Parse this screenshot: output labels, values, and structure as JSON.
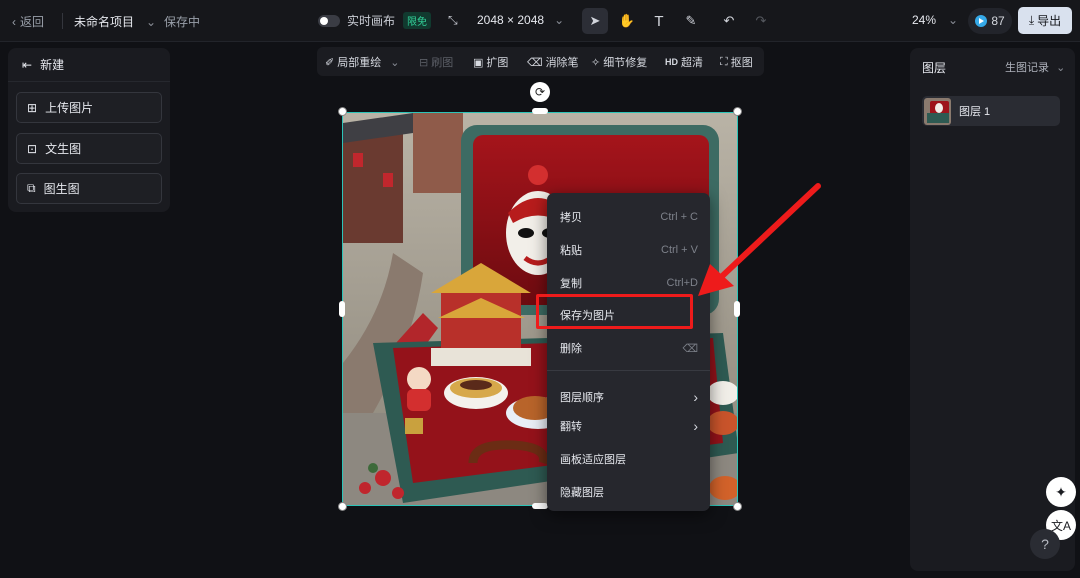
{
  "topbar": {
    "back_label": "返回",
    "project_name": "未命名项目",
    "save_status": "保存中",
    "realtime_label": "实时画布",
    "free_badge": "限免",
    "canvas_size": "2048 × 2048",
    "zoom": "24%",
    "credits": "87",
    "export_label": "导出"
  },
  "left_panel": {
    "new_label": "新建",
    "buttons": [
      {
        "label": "上传图片",
        "icon": "upload-image-icon"
      },
      {
        "label": "文生图",
        "icon": "text-to-image-icon"
      },
      {
        "label": "图生图",
        "icon": "image-to-image-icon"
      }
    ]
  },
  "image_toolbar": {
    "items": [
      {
        "label": "局部重绘",
        "icon": "brush-icon",
        "enabled": true
      },
      {
        "label": "刷图",
        "icon": "erase-bg-icon",
        "enabled": false
      },
      {
        "label": "扩图",
        "icon": "expand-icon",
        "enabled": true
      },
      {
        "label": "消除笔",
        "icon": "eraser-icon",
        "enabled": true
      },
      {
        "label": "细节修复",
        "icon": "repair-icon",
        "enabled": true
      },
      {
        "label": "超清",
        "prefix": "HD",
        "enabled": true
      },
      {
        "label": "抠图",
        "icon": "cutout-icon",
        "enabled": true
      }
    ]
  },
  "context_menu": {
    "items": [
      {
        "label": "拷贝",
        "shortcut": "Ctrl + C"
      },
      {
        "label": "粘贴",
        "shortcut": "Ctrl + V"
      },
      {
        "label": "复制",
        "shortcut": "Ctrl+D"
      },
      {
        "label": "保存为图片",
        "shortcut": ""
      },
      {
        "label": "删除",
        "shortcut": "⌫"
      },
      {
        "label": "图层顺序",
        "shortcut": "›"
      },
      {
        "label": "翻转",
        "shortcut": "›"
      },
      {
        "label": "画板适应图层",
        "shortcut": ""
      },
      {
        "label": "隐藏图层",
        "shortcut": ""
      }
    ],
    "highlighted": "保存为图片"
  },
  "right_panel": {
    "title": "图层",
    "history_label": "生图记录",
    "layers": [
      {
        "name": "图层 1"
      }
    ]
  },
  "colors": {
    "accent_teal": "#2cc4b8",
    "highlight_red": "#ee1b1b",
    "free_green": "#33d39a"
  }
}
